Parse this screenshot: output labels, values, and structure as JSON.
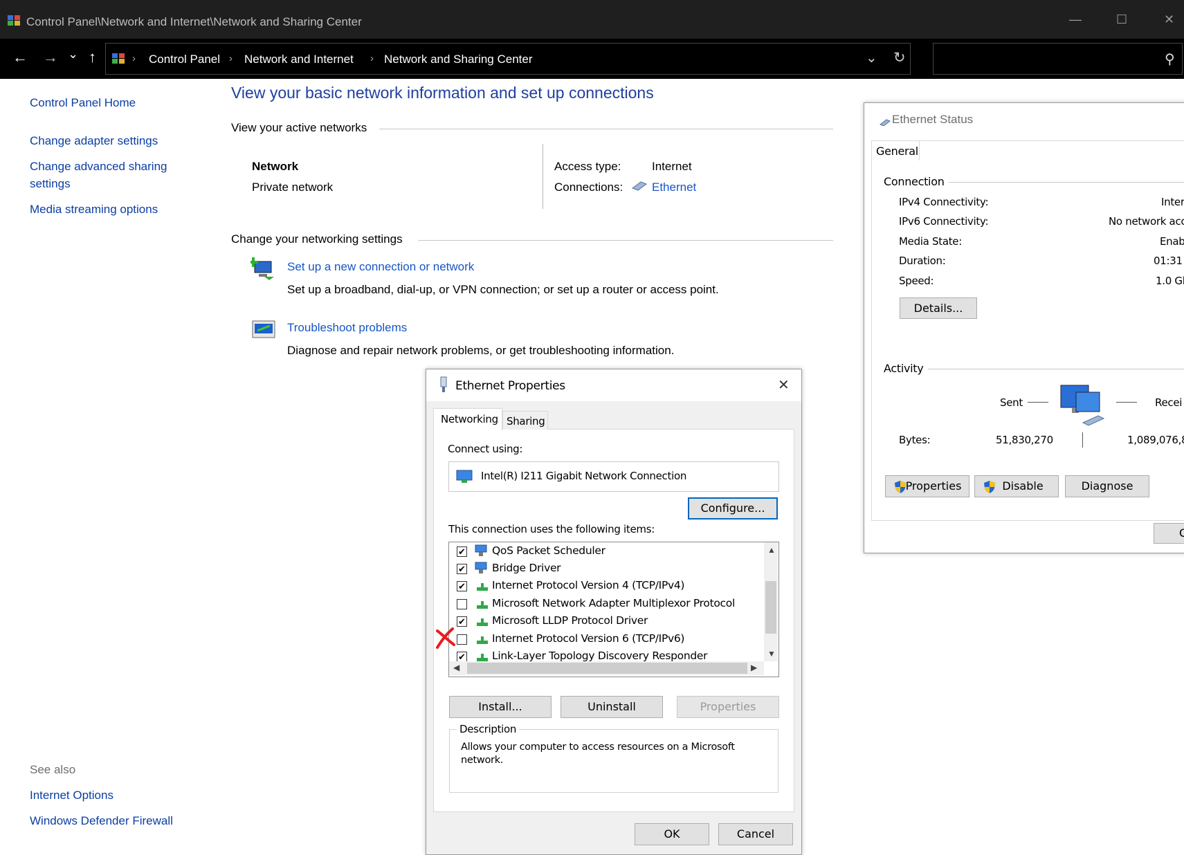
{
  "window": {
    "title": "Control Panel\\Network and Internet\\Network and Sharing Center",
    "minimize": "—",
    "maximize": "☐",
    "close": "✕"
  },
  "address": {
    "crumbs": [
      "Control Panel",
      "Network and Internet",
      "Network and Sharing Center"
    ],
    "back": "←",
    "forward": "→",
    "recent": "⌄",
    "up": "↑",
    "dropdown": "⌄",
    "refresh": "↻",
    "search_icon": "⚲"
  },
  "sidebar": {
    "home": "Control Panel Home",
    "links": [
      "Change adapter settings",
      "Change advanced sharing",
      "settings",
      "Media streaming options"
    ],
    "see_also_title": "See also",
    "see_also": [
      "Internet Options",
      "Windows Defender Firewall"
    ]
  },
  "main": {
    "title": "View your basic network information and set up connections",
    "active_networks": "View your active networks",
    "network_name": "Network",
    "network_type": "Private network",
    "access_type_label": "Access type:",
    "access_type_value": "Internet",
    "connections_label": "Connections:",
    "connections_value": "Ethernet",
    "change_settings": "Change your networking settings",
    "tasks": [
      {
        "link": "Set up a new connection or network",
        "desc": "Set up a broadband, dial-up, or VPN connection; or set up a router or access point."
      },
      {
        "link": "Troubleshoot problems",
        "desc": "Diagnose and repair network problems, or get troubleshooting information."
      }
    ]
  },
  "ethernet_status": {
    "title": "Ethernet Status",
    "tab": "General",
    "connection_section": "Connection",
    "rows": [
      {
        "label": "IPv4 Connectivity:",
        "value": "Inter"
      },
      {
        "label": "IPv6 Connectivity:",
        "value": "No network acc"
      },
      {
        "label": "Media State:",
        "value": "Enab"
      },
      {
        "label": "Duration:",
        "value": "01:31"
      },
      {
        "label": "Speed:",
        "value": "1.0 Gl"
      }
    ],
    "details_button": "Details...",
    "activity_section": "Activity",
    "sent": "Sent",
    "received": "Recei",
    "bytes_label": "Bytes:",
    "bytes_sent": "51,830,270",
    "bytes_received": "1,089,076,8",
    "buttons": [
      "Properties",
      "Disable",
      "Diagnose"
    ],
    "close_button": "C"
  },
  "ethernet_properties": {
    "title": "Ethernet Properties",
    "close": "✕",
    "tabs": [
      "Networking",
      "Sharing"
    ],
    "connect_using_label": "Connect using:",
    "adapter": "Intel(R) I211 Gigabit Network Connection",
    "configure_button": "Configure...",
    "items_label": "This connection uses the following items:",
    "items": [
      {
        "label": "QoS Packet Scheduler",
        "checked": "✔"
      },
      {
        "label": "Bridge Driver",
        "checked": "✔"
      },
      {
        "label": "Internet Protocol Version 4 (TCP/IPv4)",
        "checked": "✔"
      },
      {
        "label": "Microsoft Network Adapter Multiplexor Protocol",
        "checked": ""
      },
      {
        "label": "Microsoft LLDP Protocol Driver",
        "checked": "✔"
      },
      {
        "label": "Internet Protocol Version 6 (TCP/IPv6)",
        "checked": ""
      },
      {
        "label": "Link-Layer Topology Discovery Responder",
        "checked": "✔"
      }
    ],
    "install_button": "Install...",
    "uninstall_button": "Uninstall",
    "properties_button": "Properties",
    "description_title": "Description",
    "description_text_1": "Allows your computer to access resources on a Microsoft",
    "description_text_2": "network.",
    "ok_button": "OK",
    "cancel_button": "Cancel"
  }
}
